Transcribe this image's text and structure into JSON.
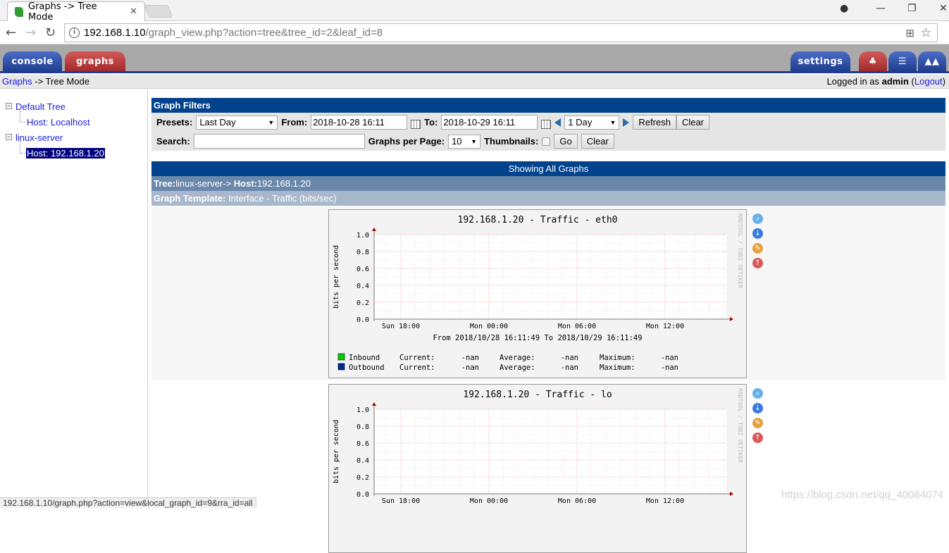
{
  "browser": {
    "tab_title": "Graphs -> Tree Mode",
    "url_host": "192.168.1.10",
    "url_path": "/graph_view.php?action=tree&tree_id=2&leaf_id=8",
    "status_url": "192.168.1.10/graph.php?action=view&local_graph_id=9&rra_id=all"
  },
  "nav": {
    "console": "console",
    "graphs": "graphs",
    "settings": "settings",
    "icons": [
      "tree-icon",
      "list-icon",
      "preview-icon"
    ]
  },
  "breadcrumb": {
    "link": "Graphs",
    "rest": " -> Tree Mode",
    "logged_prefix": "Logged in as ",
    "user": "admin",
    "logout": "Logout"
  },
  "tree": [
    {
      "label": "Default Tree"
    },
    {
      "label": "Host: Localhost"
    },
    {
      "label": "linux-server"
    },
    {
      "label": "Host: 192.168.1.20",
      "selected": true
    }
  ],
  "filters": {
    "title": "Graph Filters",
    "presets_label": "Presets:",
    "presets_value": "Last Day",
    "from_label": "From:",
    "from_value": "2018-10-28 16:11",
    "to_label": "To:",
    "to_value": "2018-10-29 16:11",
    "span_value": "1 Day",
    "refresh": "Refresh",
    "clear": "Clear",
    "search_label": "Search:",
    "search_value": "",
    "gpp_label": "Graphs per Page:",
    "gpp_value": "10",
    "thumbs_label": "Thumbnails:",
    "thumbs_checked": false,
    "go": "Go",
    "clear2": "Clear"
  },
  "listing": {
    "showing": "Showing All Graphs",
    "tree_label": "Tree:",
    "tree_value": "linux-server-> ",
    "host_label": "Host:",
    "host_value": "192.168.1.20",
    "template_label": "Graph Template:",
    "template_value": " Interface - Traffic (bits/sec)"
  },
  "graphs": [
    {
      "title": "192.168.1.20 - Traffic - eth0",
      "ylabel": "bits per second",
      "yticks": [
        "0.0",
        "0.2",
        "0.4",
        "0.6",
        "0.8",
        "1.0"
      ],
      "xticks": [
        "Sun 18:00",
        "Mon 00:00",
        "Mon 06:00",
        "Mon 12:00"
      ],
      "range": "From 2018/10/28 16:11:49 To 2018/10/29 16:11:49",
      "watermark": "RRDTOOL / TOBI OETIKER",
      "legend": [
        {
          "name": "Inbound",
          "color": "#00cf00",
          "current": "-nan",
          "average": "-nan",
          "maximum": "-nan"
        },
        {
          "name": "Outbound",
          "color": "#002a97",
          "current": "-nan",
          "average": "-nan",
          "maximum": "-nan"
        }
      ]
    },
    {
      "title": "192.168.1.20 - Traffic - lo",
      "ylabel": "bits per second",
      "yticks": [
        "0.0",
        "0.2",
        "0.4",
        "0.6",
        "0.8",
        "1.0"
      ],
      "xticks": [
        "Sun 18:00",
        "Mon 00:00",
        "Mon 06:00",
        "Mon 12:00"
      ],
      "watermark": "RRDTOOL / TOBI OETIKER"
    }
  ],
  "graph_icons": [
    "zoom-icon",
    "csv-export-icon",
    "properties-icon",
    "top-icon"
  ],
  "watermark": "https://blog.csdn.net/qq_40084074"
}
